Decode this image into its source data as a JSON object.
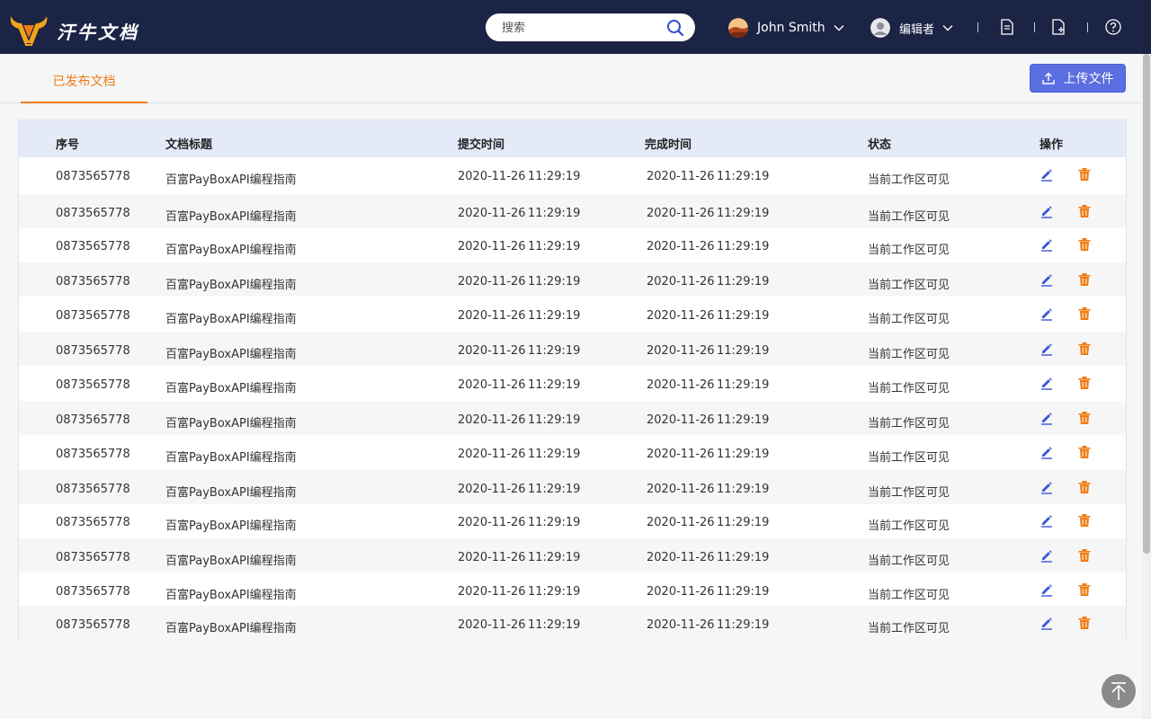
{
  "header": {
    "brand": "汗牛文档",
    "search_placeholder": "搜索",
    "user_name": "John Smith",
    "role": "编辑者",
    "colors": {
      "topbar": "#1c2445",
      "accent": "#f07c13",
      "primary": "#5b6ee1"
    }
  },
  "tabs": [
    {
      "label": "已发布文档",
      "active": true
    }
  ],
  "upload_label": "上传文件",
  "table": {
    "columns": [
      "序号",
      "文档标题",
      "提交时间",
      "完成时间",
      "状态",
      "操作"
    ],
    "rows": [
      {
        "id": "0873565778",
        "title": "百富PayBoxAPI编程指南",
        "submit_date": "2020-11-26",
        "submit_time": "11:29:19",
        "done_date": "2020-11-26",
        "done_time": "11:29:19",
        "status": "当前工作区可见"
      },
      {
        "id": "0873565778",
        "title": "百富PayBoxAPI编程指南",
        "submit_date": "2020-11-26",
        "submit_time": "11:29:19",
        "done_date": "2020-11-26",
        "done_time": "11:29:19",
        "status": "当前工作区可见"
      },
      {
        "id": "0873565778",
        "title": "百富PayBoxAPI编程指南",
        "submit_date": "2020-11-26",
        "submit_time": "11:29:19",
        "done_date": "2020-11-26",
        "done_time": "11:29:19",
        "status": "当前工作区可见"
      },
      {
        "id": "0873565778",
        "title": "百富PayBoxAPI编程指南",
        "submit_date": "2020-11-26",
        "submit_time": "11:29:19",
        "done_date": "2020-11-26",
        "done_time": "11:29:19",
        "status": "当前工作区可见"
      },
      {
        "id": "0873565778",
        "title": "百富PayBoxAPI编程指南",
        "submit_date": "2020-11-26",
        "submit_time": "11:29:19",
        "done_date": "2020-11-26",
        "done_time": "11:29:19",
        "status": "当前工作区可见"
      },
      {
        "id": "0873565778",
        "title": "百富PayBoxAPI编程指南",
        "submit_date": "2020-11-26",
        "submit_time": "11:29:19",
        "done_date": "2020-11-26",
        "done_time": "11:29:19",
        "status": "当前工作区可见"
      },
      {
        "id": "0873565778",
        "title": "百富PayBoxAPI编程指南",
        "submit_date": "2020-11-26",
        "submit_time": "11:29:19",
        "done_date": "2020-11-26",
        "done_time": "11:29:19",
        "status": "当前工作区可见"
      },
      {
        "id": "0873565778",
        "title": "百富PayBoxAPI编程指南",
        "submit_date": "2020-11-26",
        "submit_time": "11:29:19",
        "done_date": "2020-11-26",
        "done_time": "11:29:19",
        "status": "当前工作区可见"
      },
      {
        "id": "0873565778",
        "title": "百富PayBoxAPI编程指南",
        "submit_date": "2020-11-26",
        "submit_time": "11:29:19",
        "done_date": "2020-11-26",
        "done_time": "11:29:19",
        "status": "当前工作区可见"
      },
      {
        "id": "0873565778",
        "title": "百富PayBoxAPI编程指南",
        "submit_date": "2020-11-26",
        "submit_time": "11:29:19",
        "done_date": "2020-11-26",
        "done_time": "11:29:19",
        "status": "当前工作区可见"
      },
      {
        "id": "0873565778",
        "title": "百富PayBoxAPI编程指南",
        "submit_date": "2020-11-26",
        "submit_time": "11:29:19",
        "done_date": "2020-11-26",
        "done_time": "11:29:19",
        "status": "当前工作区可见"
      },
      {
        "id": "0873565778",
        "title": "百富PayBoxAPI编程指南",
        "submit_date": "2020-11-26",
        "submit_time": "11:29:19",
        "done_date": "2020-11-26",
        "done_time": "11:29:19",
        "status": "当前工作区可见"
      },
      {
        "id": "0873565778",
        "title": "百富PayBoxAPI编程指南",
        "submit_date": "2020-11-26",
        "submit_time": "11:29:19",
        "done_date": "2020-11-26",
        "done_time": "11:29:19",
        "status": "当前工作区可见"
      },
      {
        "id": "0873565778",
        "title": "百富PayBoxAPI编程指南",
        "submit_date": "2020-11-26",
        "submit_time": "11:29:19",
        "done_date": "2020-11-26",
        "done_time": "11:29:19",
        "status": "当前工作区可见"
      }
    ]
  },
  "icons": {
    "logo": "bull-head-logo",
    "search": "search-icon",
    "user_menu": "chevron-down-icon",
    "document": "document-icon",
    "add_document": "add-document-icon",
    "help": "help-icon",
    "upload": "upload-icon",
    "edit": "edit-icon",
    "delete": "trash-icon",
    "back_to_top": "arrow-up-icon"
  }
}
